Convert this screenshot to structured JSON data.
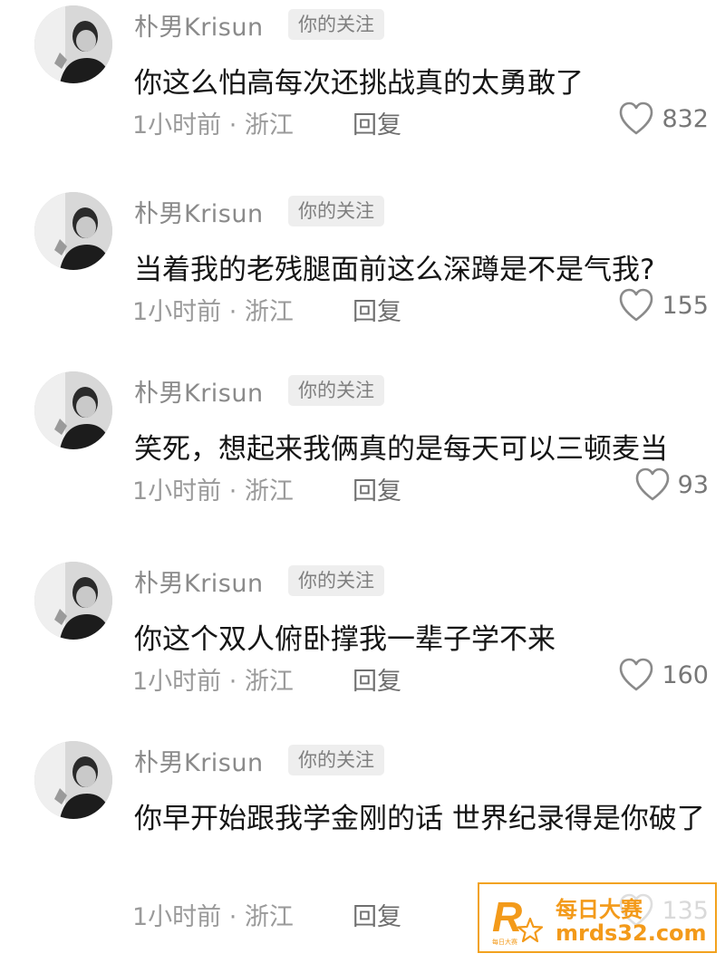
{
  "comments": [
    {
      "username": "朴男Krisun",
      "badge": "你的关注",
      "text": "你这么怕高每次还挑战真的太勇敢了",
      "meta": "1小时前 · 浙江",
      "reply": "回复",
      "likes": "832"
    },
    {
      "username": "朴男Krisun",
      "badge": "你的关注",
      "text": "当着我的老残腿面前这么深蹲是不是气我?",
      "meta": "1小时前 · 浙江",
      "reply": "回复",
      "likes": "155"
    },
    {
      "username": "朴男Krisun",
      "badge": "你的关注",
      "text": "笑死，想起来我俩真的是每天可以三顿麦当",
      "meta": "1小时前 · 浙江",
      "reply": "回复",
      "likes": "93"
    },
    {
      "username": "朴男Krisun",
      "badge": "你的关注",
      "text": "你这个双人俯卧撑我一辈子学不来",
      "meta": "1小时前 · 浙江",
      "reply": "回复",
      "likes": "160"
    },
    {
      "username": "朴男Krisun",
      "badge": "你的关注",
      "text": "你早开始跟我学金刚的话  世界纪录得是你破了",
      "meta": "1小时前 · 浙江",
      "reply": "回复",
      "likes": "135"
    }
  ],
  "watermark": {
    "logo_letter": "R",
    "logo_small": "每日大赛",
    "title": "每日大赛",
    "url": "mrds32.com",
    "color": "#f39a1a"
  },
  "icons": {
    "avatar": "avatar-photo-icon",
    "like": "heart-outline-icon",
    "watermark_logo": "star-logo-icon"
  }
}
